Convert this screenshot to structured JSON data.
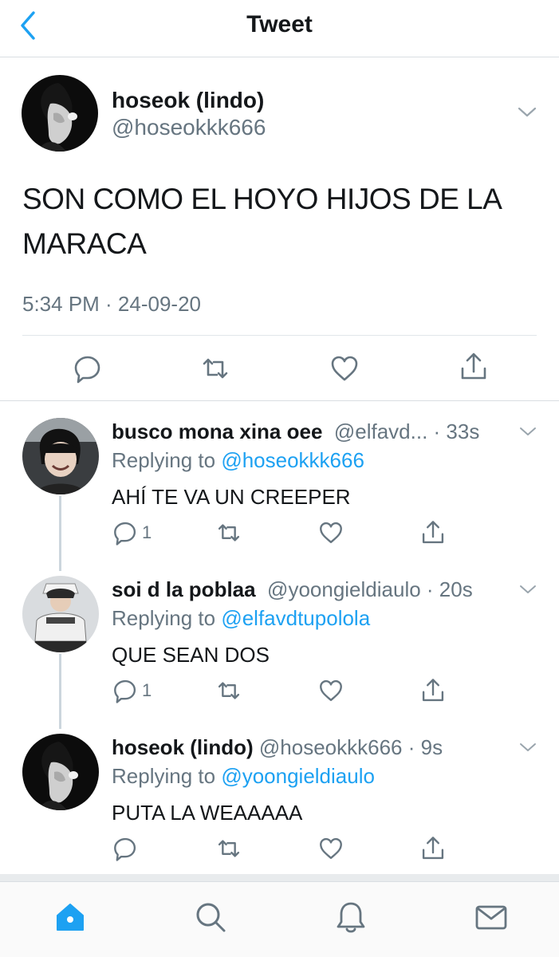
{
  "header": {
    "title": "Tweet",
    "back_icon": "chevron-left-icon"
  },
  "colors": {
    "accent": "#1da1f2",
    "secondary_text": "#667580",
    "icon_gray": "#667580"
  },
  "main_tweet": {
    "display_name": "hoseok (lindo)",
    "handle": "@hoseokkk666",
    "text": "SON COMO EL HOYO HIJOS DE LA MARACA",
    "timestamp": "5:34 PM · 24-09-20",
    "actions": [
      "reply-icon",
      "retweet-icon",
      "like-icon",
      "share-icon"
    ]
  },
  "replies": [
    {
      "display_name": "busco mona xina oee",
      "handle": "@elfavd...",
      "time": "· 33s",
      "replying_prefix": "Replying to ",
      "replying_to": "@hoseokkk666",
      "text": "AHÍ TE VA UN CREEPER",
      "reply_count": "1"
    },
    {
      "display_name": "soi d la poblaa",
      "handle": "@yoongieldiaulo",
      "time": "· 20s",
      "replying_prefix": "Replying to ",
      "replying_to": "@elfavdtupololа",
      "text": "QUE SEAN DOS",
      "reply_count": "1"
    },
    {
      "display_name": "hoseok (lindo)",
      "handle": "@hoseokkk666",
      "time": "· 9s",
      "replying_prefix": "Replying to ",
      "replying_to": "@yoongieldiaulo",
      "text": "PUTA LA WEAAAAA",
      "reply_count": ""
    }
  ],
  "tabbar": {
    "items": [
      "home-icon",
      "search-icon",
      "notifications-icon",
      "messages-icon"
    ],
    "active": "home-icon"
  }
}
